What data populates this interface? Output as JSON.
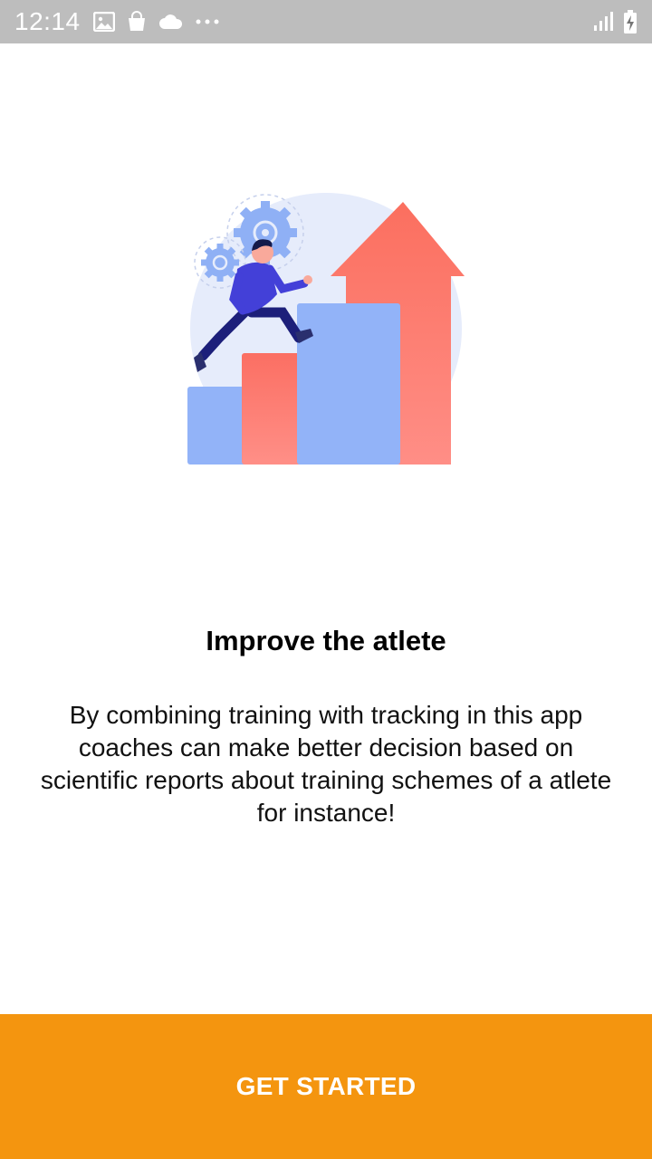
{
  "status_bar": {
    "time": "12:14",
    "left_icons": [
      "image-icon",
      "shopping-bag-icon",
      "cloud-icon",
      "more-dots-icon"
    ],
    "right_icons": [
      "signal-icon",
      "battery-charging-icon"
    ],
    "background_color": "#bdbdbd"
  },
  "onboarding": {
    "illustration": "person-climbing-bar-chart-illustration",
    "title": "Improve the atlete",
    "description": "By combining training with tracking in this app coaches can make better decision based on scientific reports about training schemes of a atlete for instance!"
  },
  "cta": {
    "label": "GET STARTED",
    "color": "#f4950f"
  }
}
